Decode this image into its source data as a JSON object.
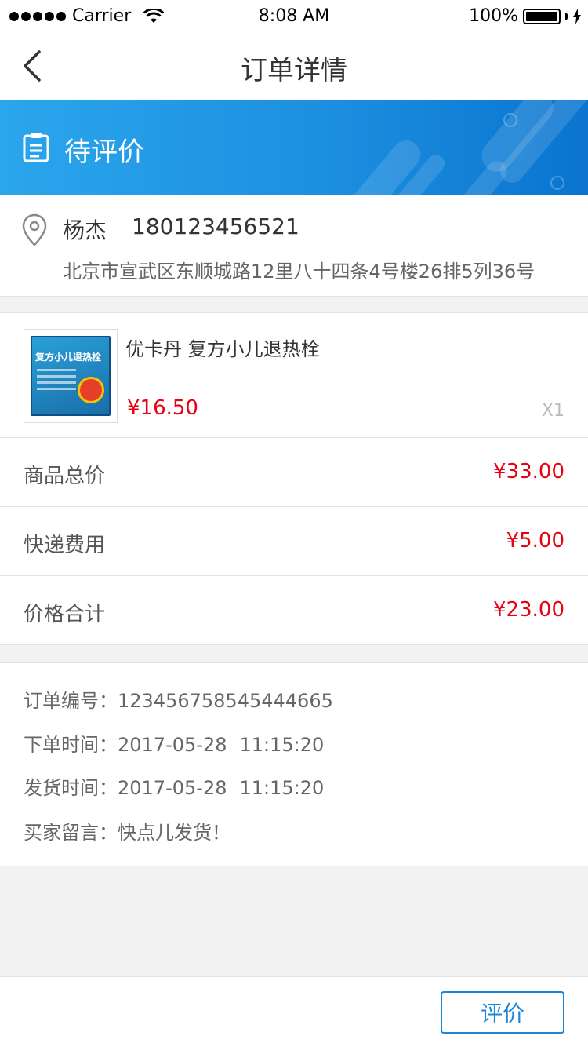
{
  "status_bar": {
    "carrier": "Carrier",
    "time": "8:08 AM",
    "battery": "100%"
  },
  "nav": {
    "title": "订单详情",
    "back_icon": "chevron-left-icon"
  },
  "banner": {
    "status": "待评价",
    "icon": "clipboard-icon",
    "gradient_start": "#2aa6ec",
    "gradient_end": "#0a74cf"
  },
  "address": {
    "name": "杨杰",
    "phone": "180123456521",
    "detail": "北京市宣武区东顺城路12里八十四条4号楼26排5列36号",
    "icon": "location-pin-icon"
  },
  "goods": {
    "name": "优卡丹 复方小儿退热栓",
    "price": "¥16.50",
    "qty": "X1",
    "package_text": "复方小儿退热栓"
  },
  "fees": [
    {
      "label": "商品总价",
      "value": "¥33.00"
    },
    {
      "label": "快递费用",
      "value": "¥5.00"
    },
    {
      "label": "价格合计",
      "value": "¥23.00"
    }
  ],
  "info": {
    "order_no_label": "订单编号：",
    "order_no": "123456758545444665",
    "order_time_label": "下单时间：",
    "order_time_date": "2017-05-28",
    "order_time_clock": "11:15:20",
    "ship_time_label": "发货时间：",
    "ship_time_date": "2017-05-28",
    "ship_time_clock": "11:15:20",
    "message_label": "买家留言：",
    "message": "快点儿发货！"
  },
  "footer": {
    "evaluate_label": "评价"
  },
  "colors": {
    "accent": "#1a86d9",
    "price": "#e50012"
  }
}
